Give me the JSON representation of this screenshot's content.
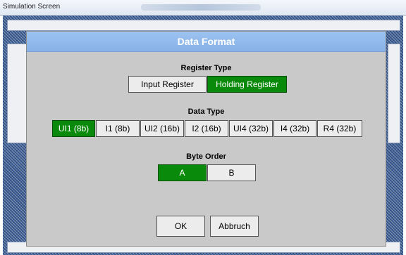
{
  "window": {
    "title": "Simulation Screen"
  },
  "dialog": {
    "title": "Data Format",
    "register_type": {
      "label": "Register Type",
      "options": [
        "Input Register",
        "Holding Register"
      ],
      "selected": "Holding Register"
    },
    "data_type": {
      "label": "Data Type",
      "options": [
        "UI1 (8b)",
        "I1 (8b)",
        "UI2 (16b)",
        "I2 (16b)",
        "UI4 (32b)",
        "I4 (32b)",
        "R4 (32b)"
      ],
      "selected": "UI1 (8b)"
    },
    "byte_order": {
      "label": "Byte Order",
      "options": [
        "A",
        "B"
      ],
      "selected": "A"
    },
    "ok_label": "OK",
    "cancel_label": "Abbruch"
  },
  "colors": {
    "active_button": "#0a8a0a",
    "header": "#9cc2ef"
  }
}
